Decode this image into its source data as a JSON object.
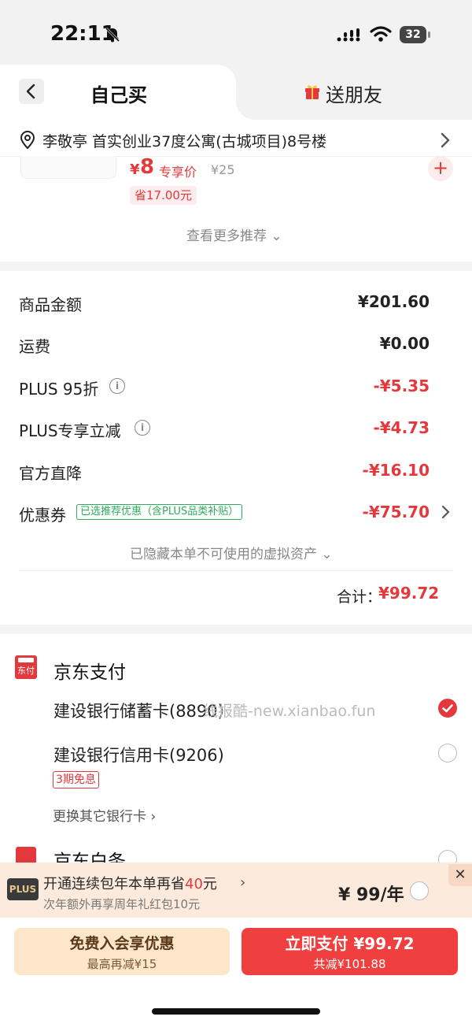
{
  "status_bar": {
    "time": "22:11",
    "battery": "32"
  },
  "tabs": {
    "self": "自己买",
    "gift": "送朋友"
  },
  "address": {
    "text": "李敬亭  首实创业37度公寓(古城项目)8号楼"
  },
  "product": {
    "currency": "¥",
    "price": "8",
    "tag": "专享价",
    "original": "¥25",
    "saving": "省17.00元"
  },
  "more_recommend": "查看更多推荐 ⌄",
  "summary": {
    "rows": [
      {
        "label": "商品金额",
        "value": "¥201.60"
      },
      {
        "label": "运费",
        "value": "¥0.00"
      },
      {
        "label": "PLUS 95折",
        "value": "-¥5.35"
      },
      {
        "label": "PLUS专享立减",
        "value": "-¥4.73"
      },
      {
        "label": "官方直降",
        "value": "-¥16.10"
      },
      {
        "label": "优惠券",
        "value": "-¥75.70"
      }
    ],
    "coupon_tag": "已选推荐优惠（含PLUS品类补贴）",
    "hidden_note": "已隐藏本单不可使用的虚拟资产 ⌄",
    "total_label": "合计：",
    "total_value": "¥99.72"
  },
  "payment": {
    "jd_icon_text": "东付",
    "jd_pay": "京东支付",
    "debit_card": "建设银行储蓄卡(8890)",
    "credit_card": "建设银行信用卡(9206)",
    "interest_free": "3期免息",
    "change_card": "更换其它银行卡 ›",
    "baitiao": "京东白条",
    "watermark": "线报酷-new.xianbao.fun"
  },
  "plus_banner": {
    "badge": "PLUS",
    "title_pre": "开通连续包年本单再省",
    "title_num": "40",
    "title_post": "元",
    "subtitle": "次年额外再享周年礼红包10元",
    "price": "¥ 99/年",
    "close": "✕"
  },
  "bottom": {
    "join_title": "免费入会享优惠",
    "join_sub": "最高再减¥15",
    "pay_title": "立即支付 ¥99.72",
    "pay_sub": "共减¥101.88"
  },
  "colors": {
    "accent": "#e4393c",
    "coupon_green": "#2fab5c",
    "plus_bg": "#fcebdc",
    "pay_button": "#f03f3f"
  }
}
